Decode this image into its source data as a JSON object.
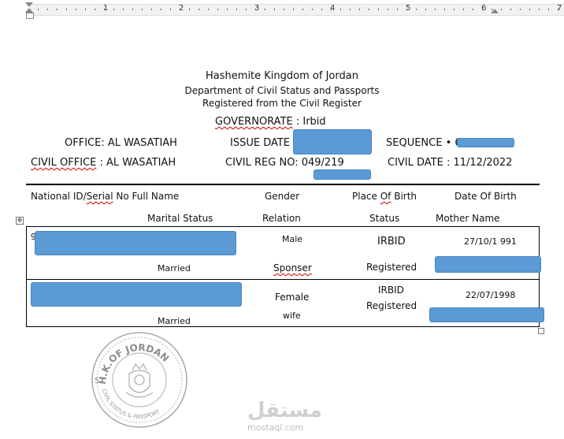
{
  "ruler": {
    "numbers": [
      "1",
      "2",
      "3",
      "4",
      "5",
      "6",
      "7"
    ]
  },
  "header": {
    "line1": "Hashemite Kingdom of Jordan",
    "line2": "Department of Civil Status and Passports",
    "line3": "Registered from the Civil Register",
    "governorate_label": "GOVERNORATE",
    "governorate_value": ": Irbid"
  },
  "info": {
    "office": "OFFICE: AL WASATIAH",
    "issue_date": "ISSUE DATE :",
    "sequence": "SEQUENCE • 6",
    "civil_office_label": "CIVIL OFFICE",
    "civil_office_value": ": AL WASATIAH",
    "civil_reg_no": "CIVIL REG NO: 049/219",
    "civil_date": "CIVIL DATE : 11/12/2022"
  },
  "columns": {
    "national_id": "National ID/",
    "serial": "Serial",
    "no_full_name": " No Full Name",
    "gender": "Gender",
    "place": "Place ",
    "of": "Of",
    "birth": " Birth",
    "date_of_birth": "Date Of Birth",
    "marital_status": "Marital Status",
    "relation": "Relation",
    "status": "Status",
    "mother_name": "Mother Name"
  },
  "rows": [
    {
      "prefix": "9",
      "gender": "Male",
      "place": "IRBID",
      "dob": "27/10/1 991",
      "marital": "Married",
      "relation": "Sponser",
      "status": "Registered"
    },
    {
      "prefix": "",
      "gender": "Female",
      "place": "IRBID",
      "dob": "22/07/1998",
      "marital": "Married",
      "relation": "wife",
      "status": "Registered"
    }
  ],
  "stamp": {
    "text_top": "H.K.OF JORDAN",
    "text_bottom": "CIVIL STATUS & PASSPORT",
    "number": "5"
  },
  "watermark": {
    "arabic": "مستقل",
    "latin": "mostaql.com"
  },
  "colors": {
    "redaction": "#5b9bd5",
    "squiggle": "#cc0000",
    "stamp": "#9a9a9a"
  }
}
